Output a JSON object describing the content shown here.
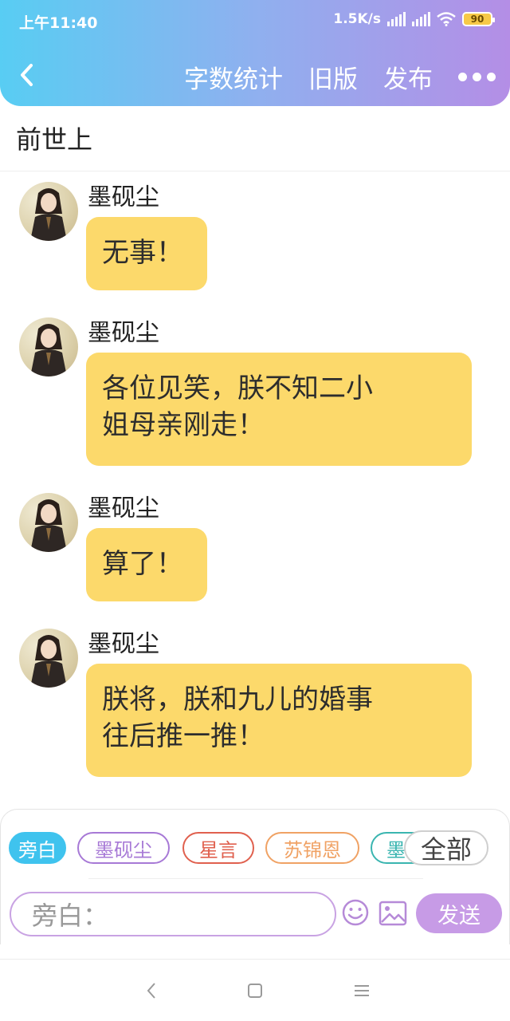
{
  "status_bar": {
    "time": "上午11:40",
    "network_speed": "1.5K/s",
    "battery": "90"
  },
  "nav": {
    "back_icon": "chevron-left-icon",
    "actions": [
      "字数统计",
      "旧版",
      "发布"
    ],
    "more_icon": "more-dots-icon"
  },
  "chapter": {
    "title": "前世上"
  },
  "messages": [
    {
      "speaker": "墨砚尘",
      "text": "无事！"
    },
    {
      "speaker": "墨砚尘",
      "line1": "各位见笑，朕不知二小",
      "line2": "姐母亲刚走！"
    },
    {
      "speaker": "墨砚尘",
      "text": "算了！"
    },
    {
      "speaker": "墨砚尘",
      "line1": "朕将，朕和九儿的婚事",
      "line2": "往后推一推！"
    }
  ],
  "character_chips": [
    {
      "label": "旁白",
      "selected": true,
      "color": "#3fc3ee"
    },
    {
      "label": "墨砚尘",
      "selected": false,
      "color": "#a779d6"
    },
    {
      "label": "星言",
      "selected": false,
      "color": "#e0604e"
    },
    {
      "label": "苏锦恩",
      "selected": false,
      "color": "#f0a264"
    },
    {
      "label": "墨",
      "selected": false,
      "color": "#3ab5b0"
    }
  ],
  "all_chip": "全部",
  "input": {
    "placeholder": "旁白："
  },
  "send_label": "发送",
  "icons": {
    "emoji": "smiley-icon",
    "image": "image-icon"
  },
  "colors": {
    "bubble": "#fcd96b",
    "header_start": "#58cdf3",
    "header_end": "#b48ee6",
    "send": "#c79be6"
  }
}
